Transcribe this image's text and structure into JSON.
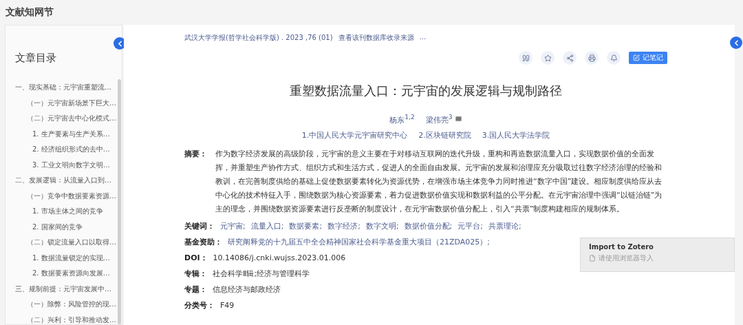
{
  "header": {
    "title": "文献知网节"
  },
  "toc": {
    "title": "文章目录",
    "items": [
      {
        "label": "一、现实基础：元宇宙重塑流…",
        "children": [
          {
            "label": "（一）元宇宙新场景下巨大…"
          },
          {
            "label": "（二）元宇宙去中心化模式…",
            "children": [
              {
                "label": "1. 生产要素与生产关系…"
              },
              {
                "label": "2. 经济组织形式的去中…"
              },
              {
                "label": "3. 工业文明向数字文明…"
              }
            ]
          }
        ]
      },
      {
        "label": "二、发展逻辑：从流量入口到…",
        "children": [
          {
            "label": "（一）竞争中数据要素资源…",
            "children": [
              {
                "label": "1. 市场主体之间的竞争"
              },
              {
                "label": "2. 国家间的竞争"
              }
            ]
          },
          {
            "label": "（二）锁定流量入口以取得…",
            "children": [
              {
                "label": "1. 数据流量锁定的实现…"
              },
              {
                "label": "2. 数据要素资源向发展…"
              }
            ]
          }
        ]
      },
      {
        "label": "三、规制前提：元宇宙发展中…",
        "children": [
          {
            "label": "（一）除弊：风险管控的现…"
          },
          {
            "label": "（二）兴利：引导和推动发…"
          }
        ]
      }
    ]
  },
  "article": {
    "source": "武汉大学学报(哲学社会科学版) .  2023 ,76 (01)",
    "source_link": "查看该刊数据库收录来源",
    "source_more": "...",
    "note_button": "记笔记",
    "title": "重塑数据流量入口：元宇宙的发展逻辑与规制路径",
    "authors": [
      {
        "name": "杨东$^{1,2}$",
        "mail": false
      },
      {
        "name": "梁伟亮$^{3}$",
        "mail": true
      }
    ],
    "affiliations": [
      "1.中国人民大学元宇宙研究中心",
      "2.区块链研究院",
      "3.国人民大学法学院"
    ],
    "fields": [
      {
        "kind": "text",
        "label": "摘要：",
        "value": "作为数字经济发展的高级阶段，元宇宙的意义主要在于对移动互联网的迭代升级，重构和再造数据流量入口，实现数据价值的全面发挥，并重塑生产协作方式、组织方式和生活方式，促进人的全面自由发展。元宇宙的发展和治理应充分吸取过往数字经济治理的经验和教训，在完善制度供给的基础上促使数据要素转化为资源优势，在增强市场主体竞争力同时推进“数字中国”建设。相应制度供给应从去中心化的技术特征入手，围绕数据为核心资源要素，着力促进数据价值实现和数据利益的公平分配。在元宇宙治理中强调“以链治链”为主的理念，并围绕数据资源要素进行反垄断的制度设计，在元宇宙数据价值分配上，引入“共票”制度构建相应的规制体系。"
      },
      {
        "kind": "links",
        "label": "关键词：",
        "values": [
          "元宇宙;",
          "流量入口;",
          "数据要素;",
          "数字经济;",
          "数字文明;",
          "数据价值分配;",
          "元平台;",
          "共票理论;"
        ]
      },
      {
        "kind": "links",
        "label": "基金资助：",
        "values": [
          "研究阐释党的十九届五中全会精神国家社会科学基金重大项目（21ZDA025）;"
        ]
      },
      {
        "kind": "plain",
        "label": "DOI：",
        "value": "10.14086/j.cnki.wujss.2023.01.006"
      },
      {
        "kind": "plain",
        "label": "专辑：",
        "value": "社会科学Ⅱ辑;经济与管理科学"
      },
      {
        "kind": "plain",
        "label": "专题：",
        "value": "信息经济与邮政经济"
      },
      {
        "kind": "plain",
        "label": "分类号：",
        "value": "F49"
      }
    ]
  },
  "zotero": {
    "title": "Import to Zotero",
    "item": "请使用浏览器导入"
  }
}
